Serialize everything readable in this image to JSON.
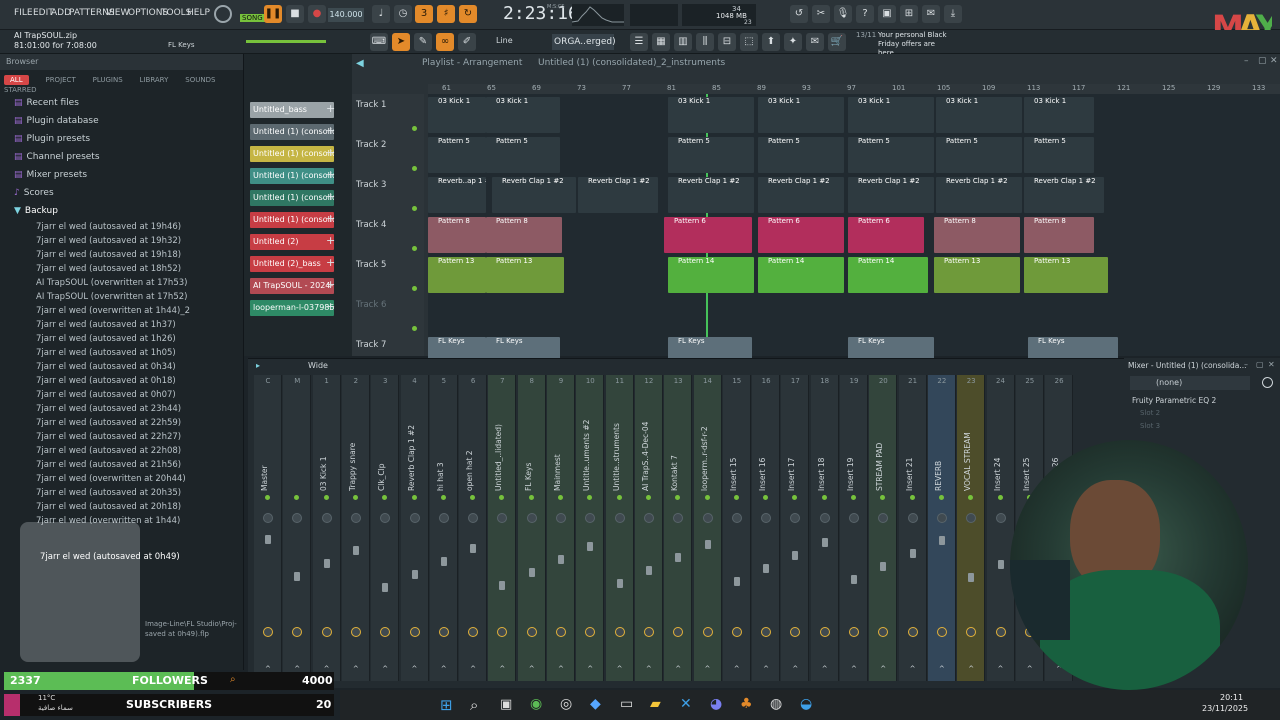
{
  "menus": [
    "FILE",
    "EDIT",
    "ADD",
    "PATTERNS",
    "VIEW",
    "OPTIONS",
    "TOOLS",
    "HELP"
  ],
  "transport": {
    "song_label": "SONG",
    "tempo": "140.000",
    "time": "2:23:16",
    "time_unit": "M:S:CS",
    "memory": "1048 MB",
    "cpu": "34",
    "voices": "23"
  },
  "hint": {
    "file": "AI TrapSOUL.zip",
    "position": "81:01:00 for 7:08:00",
    "channel": "FL Keys"
  },
  "row2": {
    "snap": "Line",
    "pattern": "ORGA..erged)",
    "news_count": "13/11",
    "news_text": "Your personal Black Friday offers are here"
  },
  "browser": {
    "title": "Browser",
    "tabs": [
      "ALL",
      "PROJECT",
      "PLUGINS",
      "LIBRARY",
      "SOUNDS",
      "STARRED"
    ],
    "categories": [
      "Recent files",
      "Plugin database",
      "Plugin presets",
      "Channel presets",
      "Mixer presets",
      "Scores",
      "Backup"
    ],
    "files": [
      "7jarr el wed (autosaved at 19h46)",
      "7jarr el wed (autosaved at 19h32)",
      "7jarr el wed (autosaved at 19h18)",
      "7jarr el wed (autosaved at 18h52)",
      "AI TrapSOUL (overwritten at 17h53)",
      "AI TrapSOUL (overwritten at 17h52)",
      "7jarr el wed (overwritten at 1h44)_2",
      "7jarr el wed (autosaved at 1h37)",
      "7jarr el wed (autosaved at 1h26)",
      "7jarr el wed (autosaved at 1h05)",
      "7jarr el wed (autosaved at 0h34)",
      "7jarr el wed (autosaved at 0h18)",
      "7jarr el wed (autosaved at 0h07)",
      "7jarr el wed (autosaved at 23h44)",
      "7jarr el wed (autosaved at 22h59)",
      "7jarr el wed (autosaved at 22h27)",
      "7jarr el wed (autosaved at 22h08)",
      "7jarr el wed (autosaved at 21h56)",
      "7jarr el wed (overwritten at 20h44)",
      "7jarr el wed (autosaved at 20h35)",
      "7jarr el wed (autosaved at 20h18)",
      "7jarr el wed (overwritten at 1h44)"
    ],
    "selected_file": "7jarr el wed (autosaved at 0h49)",
    "status_path": "Image-Line\\FL Studio\\Proj-",
    "status_saved": "saved at 0h49).flp"
  },
  "channels": [
    {
      "name": "Untitled_bass",
      "color": "#9aa3a7"
    },
    {
      "name": "Untitled (1) (consolid...",
      "color": "#5c6970"
    },
    {
      "name": "Untitled (1) (consolid...",
      "color": "#c5b544"
    },
    {
      "name": "Untitled (1) (consolid...",
      "color": "#3f8f86"
    },
    {
      "name": "Untitled (1) (consolid...",
      "color": "#2f7763"
    },
    {
      "name": "Untitled (1) (consolid...",
      "color": "#c73d44"
    },
    {
      "name": "Untitled (2)",
      "color": "#c73d44"
    },
    {
      "name": "Untitled (2)_bass",
      "color": "#c73d44"
    },
    {
      "name": "AI TrapSOUL - 2024-...",
      "color": "#b24a53"
    },
    {
      "name": "looperman-l-037985...",
      "color": "#2e8a66"
    }
  ],
  "playlist": {
    "title": "Playlist - Arrangement",
    "breadcrumb": "Untitled (1) (consolidated)_2_instruments",
    "ruler": [
      "61",
      "65",
      "69",
      "73",
      "77",
      "81",
      "85",
      "89",
      "93",
      "97",
      "101",
      "105",
      "109",
      "113",
      "117",
      "121",
      "125",
      "129",
      "133"
    ],
    "tracks": [
      "Track 1",
      "Track 2",
      "Track 3",
      "Track 4",
      "Track 5",
      "Track 6",
      "Track 7"
    ],
    "clip_labels": {
      "t1": "03 Kick 1",
      "t2": "Pattern 5",
      "t3a": "Reverb..ap 1 #2",
      "t3b": "Reverb Clap 1 #2",
      "t4a": "Pattern 8",
      "t4b": "Pattern 6",
      "t5a": "Pattern 13",
      "t5b": "Pattern 14",
      "t7": "FL Keys"
    }
  },
  "mixer": {
    "title": "Mixer - Untitled (1) (consolida...",
    "mode": "Wide",
    "insert_none": "(none)",
    "effect_slot": "Fruity Parametric EQ 2",
    "slots": [
      "Slot 2",
      "Slot 3"
    ],
    "strips": [
      {
        "num": "C",
        "name": "Master"
      },
      {
        "num": "M",
        "name": ""
      },
      {
        "num": "1",
        "name": "03 Kick 1"
      },
      {
        "num": "2",
        "name": "Trappy snare"
      },
      {
        "num": "3",
        "name": "Clk_Clp"
      },
      {
        "num": "4",
        "name": "Reverb Clap 1 #2"
      },
      {
        "num": "5",
        "name": "hi hat 3"
      },
      {
        "num": "6",
        "name": "open hat 2"
      },
      {
        "num": "7",
        "name": "Untitled_..lidated)"
      },
      {
        "num": "8",
        "name": "FL Keys"
      },
      {
        "num": "9",
        "name": "Mainmest"
      },
      {
        "num": "10",
        "name": "Untitle..uments #2"
      },
      {
        "num": "11",
        "name": "Untitle..struments"
      },
      {
        "num": "12",
        "name": "AI TrapS..4-Dec-04"
      },
      {
        "num": "13",
        "name": "Kontakt 7"
      },
      {
        "num": "14",
        "name": "looperm..r-dsf-r-2"
      },
      {
        "num": "15",
        "name": "Insert 15"
      },
      {
        "num": "16",
        "name": "Insert 16"
      },
      {
        "num": "17",
        "name": "Insert 17"
      },
      {
        "num": "18",
        "name": "Insert 18"
      },
      {
        "num": "19",
        "name": "Insert 19"
      },
      {
        "num": "20",
        "name": "STREAM PAD"
      },
      {
        "num": "21",
        "name": "Insert 21"
      },
      {
        "num": "22",
        "name": "REVERB"
      },
      {
        "num": "23",
        "name": "VOCAL STREAM"
      },
      {
        "num": "24",
        "name": "Insert 24"
      },
      {
        "num": "25",
        "name": "Insert 25"
      },
      {
        "num": "26",
        "name": "Insert 26"
      }
    ]
  },
  "overlay": {
    "followers_count": "2337",
    "followers_label": "FOLLOWERS",
    "followers_goal": "4000",
    "subs_label": "SUBSCRIBERS",
    "subs_count": "20"
  },
  "taskbar": {
    "time": "20:11",
    "date": "23/11/2025",
    "weather_temp": "11°C",
    "weather_text": "سماء صافية"
  },
  "colors": {
    "accent": "#e38a2a",
    "green": "#77c23c",
    "red": "#d64747"
  }
}
